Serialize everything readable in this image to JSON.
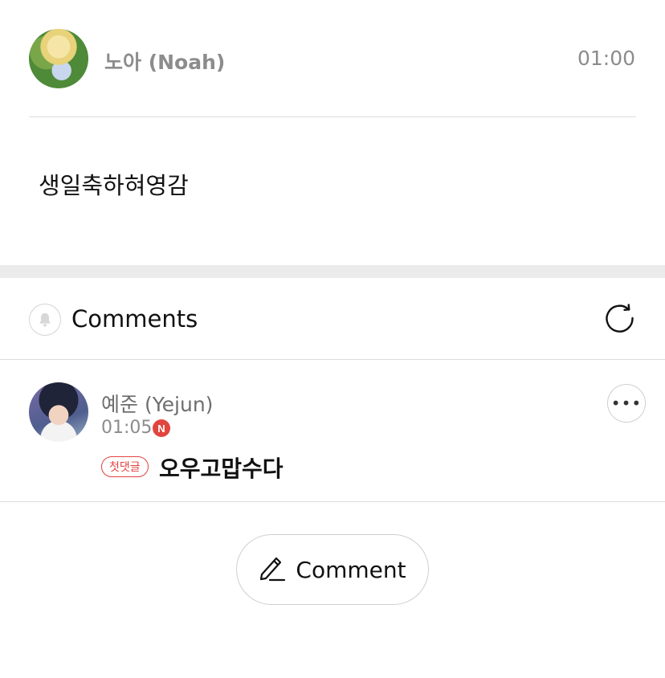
{
  "post": {
    "author": "노아 (Noah)",
    "time": "01:00",
    "body": "생일축하혀영감"
  },
  "comments_section": {
    "title": "Comments"
  },
  "comment": {
    "author": "예준 (Yejun)",
    "time": "01:05",
    "new_badge": "N",
    "first_badge": "첫댓글",
    "text": "오우고맙수다",
    "more_label": "•••"
  },
  "write_button": {
    "label": "Comment"
  },
  "colors": {
    "accent_red": "#e2443f",
    "divider": "#dcdcdc",
    "section_gap": "#ebebeb"
  }
}
